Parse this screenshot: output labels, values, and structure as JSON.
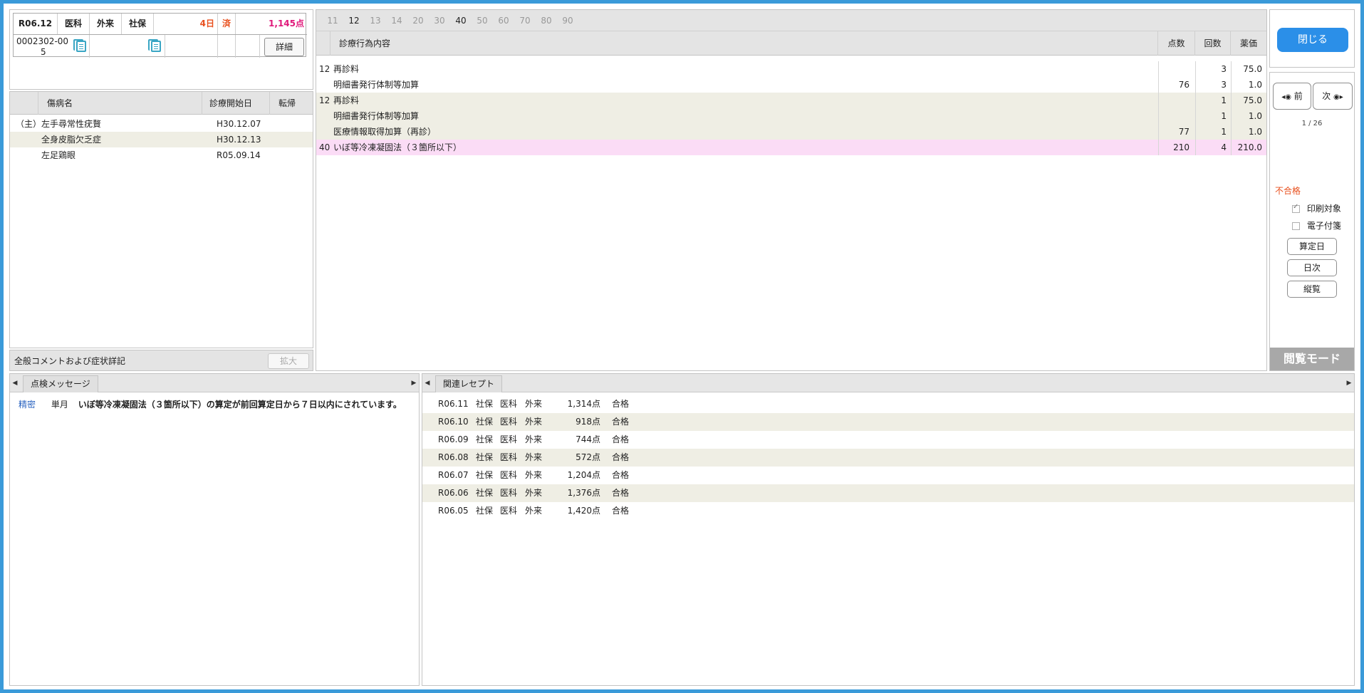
{
  "receipt": {
    "month": "R06.12",
    "dept": "医科",
    "inout": "外来",
    "insurance": "社保",
    "days": "4日",
    "status": "済",
    "points": "1,145点",
    "patient_id": "0002302-00",
    "patient_id_2": "5",
    "detail_label": "詳細"
  },
  "disease_table": {
    "headers": [
      "傷病名",
      "診療開始日",
      "転帰"
    ],
    "rows": [
      {
        "prefix": "（主）",
        "name": "左手尋常性疣贅",
        "date": "H30.12.07",
        "outcome": ""
      },
      {
        "prefix": "",
        "name": "全身皮脂欠乏症",
        "date": "H30.12.13",
        "outcome": ""
      },
      {
        "prefix": "",
        "name": "左足鶏眼",
        "date": "R05.09.14",
        "outcome": ""
      }
    ]
  },
  "comment_bar": {
    "label": "全般コメントおよび症状詳記",
    "expand_label": "拡大"
  },
  "category_tabs": [
    "11",
    "12",
    "13",
    "14",
    "20",
    "30",
    "40",
    "50",
    "60",
    "70",
    "80",
    "90"
  ],
  "active_tabs": [
    "12",
    "40"
  ],
  "treatment_table": {
    "headers": [
      "診療行為内容",
      "点数",
      "回数",
      "薬価"
    ],
    "rows": [
      {
        "code": "12",
        "content": "再診料",
        "points": "",
        "count": "3",
        "price": "75.0",
        "style": "plain"
      },
      {
        "code": "",
        "content": "明細書発行体制等加算",
        "points": "76",
        "count": "3",
        "price": "1.0",
        "style": "plain"
      },
      {
        "code": "12",
        "content": "再診料",
        "points": "",
        "count": "1",
        "price": "75.0",
        "style": "stripe"
      },
      {
        "code": "",
        "content": "明細書発行体制等加算",
        "points": "",
        "count": "1",
        "price": "1.0",
        "style": "stripe"
      },
      {
        "code": "",
        "content": "医療情報取得加算（再診）",
        "points": "77",
        "count": "1",
        "price": "1.0",
        "style": "stripe"
      },
      {
        "code": "40",
        "content": "いぼ等冷凍凝固法（３箇所以下）",
        "points": "210",
        "count": "4",
        "price": "210.0",
        "style": "highlight"
      }
    ]
  },
  "right_panel": {
    "close_label": "閉じる",
    "prev_label": "前",
    "next_label": "次",
    "page_indicator": "1 / 26",
    "fail_label": "不合格",
    "print_label": "印刷対象",
    "print_checked": true,
    "etag_label": "電子付箋",
    "etag_checked": false,
    "calc_day_label": "算定日",
    "daily_label": "日次",
    "vertical_label": "縦覧",
    "mode_label": "閲覧モード"
  },
  "check_messages": {
    "tab_label": "点検メッセージ",
    "items": [
      {
        "level": "精密",
        "period": "単月",
        "text": "いぼ等冷凍凝固法（３箇所以下）の算定が前回算定日から７日以内にされています。"
      }
    ]
  },
  "related_receipts": {
    "tab_label": "関連レセプト",
    "rows": [
      {
        "month": "R06.11",
        "insurance": "社保",
        "dept": "医科",
        "inout": "外来",
        "points": "1,314点",
        "result": "合格"
      },
      {
        "month": "R06.10",
        "insurance": "社保",
        "dept": "医科",
        "inout": "外来",
        "points": "918点",
        "result": "合格"
      },
      {
        "month": "R06.09",
        "insurance": "社保",
        "dept": "医科",
        "inout": "外来",
        "points": "744点",
        "result": "合格"
      },
      {
        "month": "R06.08",
        "insurance": "社保",
        "dept": "医科",
        "inout": "外来",
        "points": "572点",
        "result": "合格"
      },
      {
        "month": "R06.07",
        "insurance": "社保",
        "dept": "医科",
        "inout": "外来",
        "points": "1,204点",
        "result": "合格"
      },
      {
        "month": "R06.06",
        "insurance": "社保",
        "dept": "医科",
        "inout": "外来",
        "points": "1,376点",
        "result": "合格"
      },
      {
        "month": "R06.05",
        "insurance": "社保",
        "dept": "医科",
        "inout": "外来",
        "points": "1,420点",
        "result": "合格"
      }
    ]
  },
  "colors": {
    "frame": "#3a9ad9",
    "accent_orange": "#e8501e",
    "accent_pink": "#e0187a",
    "highlight_row": "#fbdcf6",
    "stripe_row": "#efeee4",
    "close_button": "#2b8fe8",
    "link_blue": "#2a63c0"
  }
}
